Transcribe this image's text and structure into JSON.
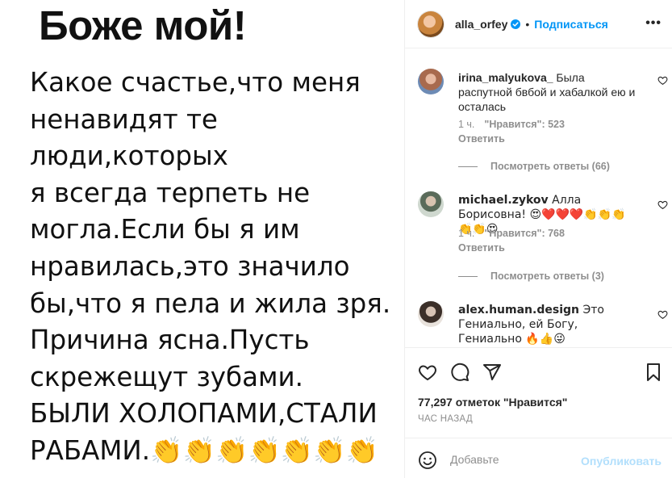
{
  "post": {
    "heading": "Боже мой!",
    "body": "Какое счастье,что меня\nненавидят те люди,которых\nя всегда терпеть не\nмогла.Если бы я им\nнравилась,это значило\nбы,что я пела и жила зря.\nПричина ясна.Пусть\nскрежещут зубами.\nБЫЛИ ХОЛОПАМИ,СТАЛИ\nРАБАМИ.👏👏👏👏👏👏👏"
  },
  "header": {
    "username": "alla_orfey",
    "separator": "•",
    "follow_label": "Подписаться",
    "more_label": "•••"
  },
  "comments": [
    {
      "username": "irina_malyukova_",
      "text": "Была распутной бвбой и хабалкой ею и осталась",
      "time": "1 ч.",
      "likes": "\"Нравится\": 523",
      "reply": "Ответить",
      "view_replies": "Посмотреть ответы (66)"
    },
    {
      "username": "michael.zykov",
      "text": "Алла Борисовна! 😍❤️❤️❤️👏👏👏👏👏😍",
      "time": "1 ч.",
      "likes": "\"Нравится\": 768",
      "reply": "Ответить",
      "view_replies": "Посмотреть ответы (3)"
    },
    {
      "username": "alex.human.design",
      "text": "Это Гениально, ей Богу, Гениально 🔥👍😜"
    }
  ],
  "actions": {
    "likes": "77,297 отметок \"Нравится\"",
    "timestamp": "ЧАС НАЗАД"
  },
  "add_comment": {
    "placeholder": "Добавьте",
    "publish_label": "Опубликовать"
  },
  "icons": [
    "verified-icon",
    "more-icon",
    "heart-icon",
    "comment-icon",
    "share-icon",
    "bookmark-icon",
    "smile-icon"
  ],
  "colors": {
    "accent": "#0095f6",
    "muted": "#8e8e8e",
    "publish_disabled": "#b2dffc",
    "text": "#262626"
  }
}
